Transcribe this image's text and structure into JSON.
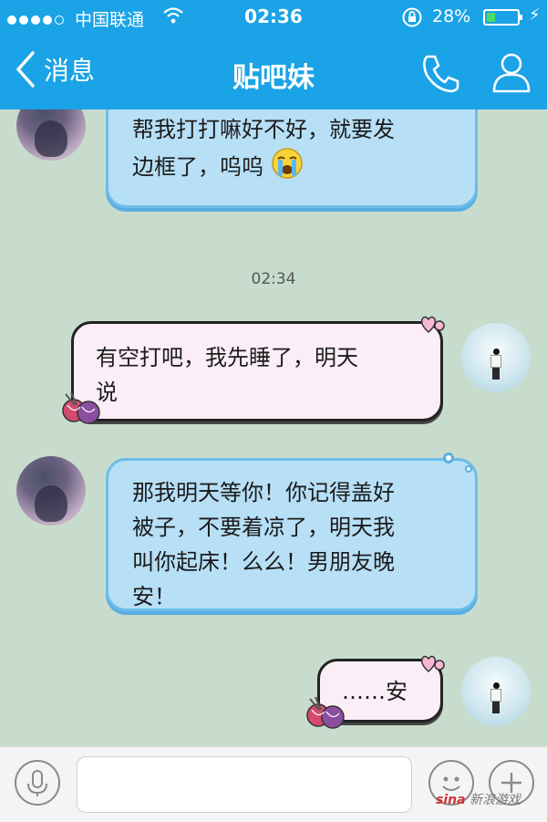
{
  "status_bar": {
    "carrier": "中国联通",
    "time": "02:36",
    "battery_percent": "28%",
    "battery_level": 0.28,
    "signal_bars": 4
  },
  "nav": {
    "back_label": "消息",
    "title": "贴吧妹",
    "phone_icon": "phone-icon",
    "contact_icon": "contact-icon"
  },
  "messages": [
    {
      "side": "left",
      "text_line1": "帮我打打嘛好不好，就要发",
      "text_line2": "边框了，呜呜",
      "emoji": "crying-emoji"
    },
    {
      "type": "timestamp",
      "text": "02:34"
    },
    {
      "side": "right",
      "text_line1": "有空打吧，我先睡了，明天",
      "text_line2": "说"
    },
    {
      "side": "left",
      "text_line1": "那我明天等你！你记得盖好",
      "text_line2": "被子，不要着凉了，明天我",
      "text_line3": "叫你起床！么么！男朋友晚",
      "text_line4": "安！"
    },
    {
      "side": "right",
      "text_line1": "……安"
    }
  ],
  "input_bar": {
    "placeholder": "",
    "voice_icon": "microphone-icon",
    "emoji_icon": "emoji-icon",
    "plus_icon": "plus-icon"
  },
  "watermark": {
    "brand": "sina",
    "text": "新浪游戏"
  },
  "colors": {
    "header": "#1aa3e6",
    "chat_background": "#c8dccd",
    "her_bubble": "#b7dff6",
    "my_bubble": "#fbeef7"
  }
}
